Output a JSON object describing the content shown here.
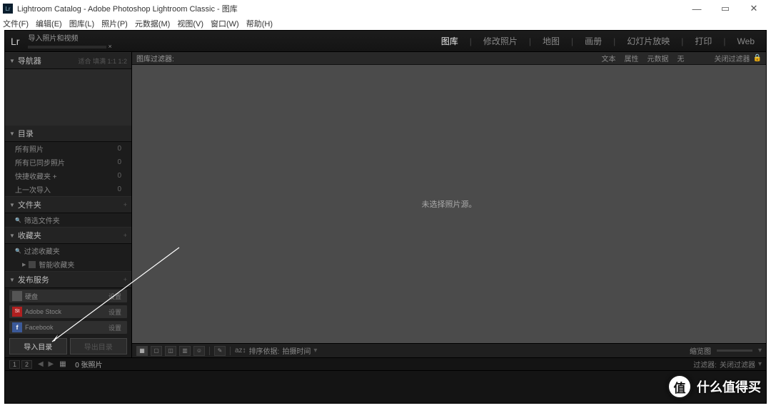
{
  "titlebar": {
    "text": "Lightroom Catalog - Adobe Photoshop Lightroom Classic - 图库"
  },
  "menubar": [
    "文件(F)",
    "编辑(E)",
    "图库(L)",
    "照片(P)",
    "元数据(M)",
    "视图(V)",
    "窗口(W)",
    "帮助(H)"
  ],
  "topstrip": {
    "logo": "Lr",
    "progress_label": "导入照片和视频",
    "modules": [
      "图库",
      "修改照片",
      "地图",
      "画册",
      "幻灯片放映",
      "打印",
      "Web"
    ],
    "active_module": "图库"
  },
  "leftpanel": {
    "navigator": {
      "title": "导航器",
      "extra": "适合 填满 1:1 1:2"
    },
    "catalog": {
      "title": "目录",
      "rows": [
        {
          "label": "所有照片",
          "count": "0"
        },
        {
          "label": "所有已同步照片",
          "count": "0"
        },
        {
          "label": "快捷收藏夹 +",
          "count": "0"
        },
        {
          "label": "上一次导入",
          "count": "0"
        }
      ]
    },
    "folders": {
      "title": "文件夹",
      "row": "筛选文件夹"
    },
    "collections": {
      "title": "收藏夹",
      "row": "过滤收藏夹",
      "sub": "智能收藏夹"
    },
    "publish": {
      "title": "发布服务",
      "rows": [
        {
          "icon": "#555",
          "label": "硬盘",
          "set": "设置"
        },
        {
          "icon": "#b02",
          "label": "Adobe Stock",
          "set": "设置"
        },
        {
          "icon": "#3b5998",
          "label": "Facebook",
          "set": "设置"
        }
      ]
    },
    "import_btn": "导入目录",
    "export_btn": "导出目录"
  },
  "filterbar": {
    "label": "图库过滤器:",
    "items": [
      "文本",
      "属性",
      "元数据",
      "无"
    ],
    "close": "关闭过滤器"
  },
  "centerbody": "未选择照片源。",
  "toolbar": {
    "sort_label": "排序依据:",
    "sort_value": "拍摄时间",
    "thumb_label": "缩览图"
  },
  "filmstrip": {
    "nav1": "1",
    "nav2": "2",
    "count": "0 张照片",
    "filter_label": "过滤器:",
    "filter_value": "关闭过滤器"
  },
  "badge": {
    "icon": "值",
    "text": "什么值得买"
  }
}
